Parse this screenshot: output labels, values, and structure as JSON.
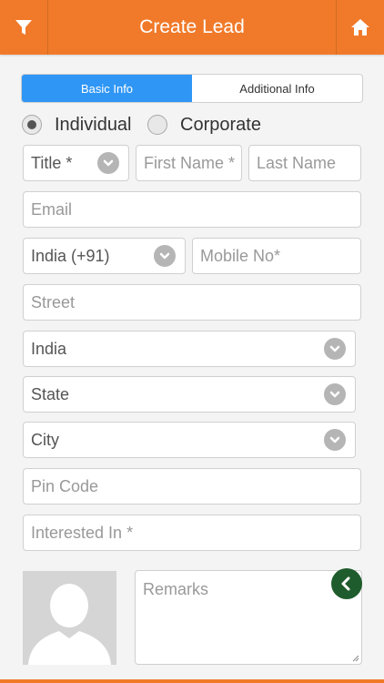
{
  "header": {
    "title": "Create Lead",
    "bg_color": "#f07a2a",
    "left_icon": "filter-icon",
    "right_icon": "home-icon"
  },
  "tabs": [
    {
      "label": "Basic Info",
      "active": true
    },
    {
      "label": "Additional Info",
      "active": false
    }
  ],
  "lead_type": {
    "options": [
      {
        "label": "Individual",
        "selected": true
      },
      {
        "label": "Corporate",
        "selected": false
      }
    ]
  },
  "form": {
    "title": {
      "value": "Title *",
      "icon": "chevron-down-icon"
    },
    "first_name": {
      "placeholder": "First Name *"
    },
    "last_name": {
      "placeholder": "Last Name"
    },
    "email": {
      "placeholder": "Email"
    },
    "country_code": {
      "value": "India (+91)",
      "icon": "chevron-down-icon"
    },
    "mobile": {
      "placeholder": "Mobile No*"
    },
    "street": {
      "placeholder": "Street"
    },
    "country": {
      "value": "India",
      "icon": "chevron-down-icon"
    },
    "state": {
      "value": "State",
      "icon": "chevron-down-icon"
    },
    "city": {
      "value": "City",
      "icon": "chevron-down-icon"
    },
    "pin_code": {
      "placeholder": "Pin Code"
    },
    "interested_in": {
      "placeholder": "Interested In *"
    },
    "remarks": {
      "placeholder": "Remarks"
    }
  },
  "avatar": {
    "icon": "person-placeholder-icon"
  },
  "back_button": {
    "icon": "chevron-left-icon",
    "color": "#1f5c2d"
  },
  "accent_color": "#2f96f5"
}
